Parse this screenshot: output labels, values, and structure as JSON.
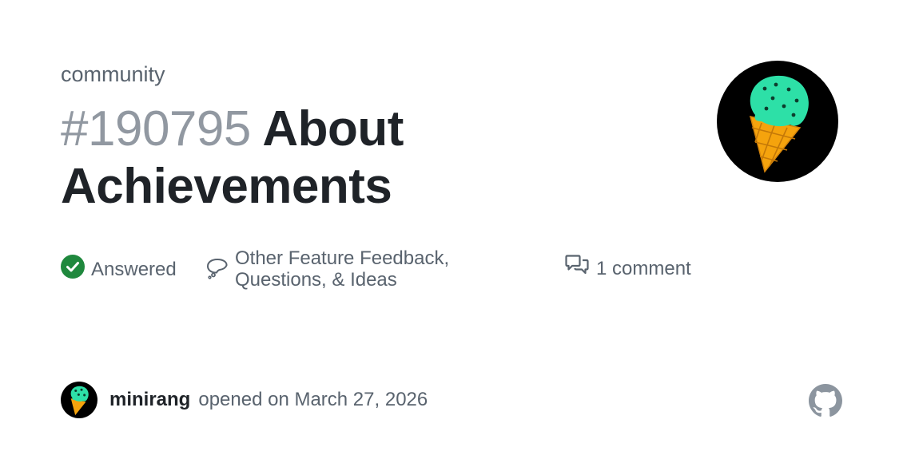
{
  "repo": {
    "owner": "community"
  },
  "discussion": {
    "number": "#190795",
    "title": "About Achievements",
    "status": "Answered",
    "category_line1": "Other Feature Feedback,",
    "category_line2": "Questions, & Ideas",
    "comments": "1 comment"
  },
  "author": {
    "username": "minirang",
    "opened": "opened on March 27, 2026",
    "avatar_icon": "ice-cream-cone-icon"
  },
  "icons": {
    "status": "check-circle-icon",
    "category": "thought-bubble-icon",
    "comments": "comment-discussion-icon",
    "brand": "github-mark-icon"
  },
  "colors": {
    "answered_green": "#1f883d",
    "mint": "#2de0a7",
    "cone_orange": "#f5a30d",
    "muted_text": "#59636e",
    "light_number": "#9198a1",
    "github_gray": "#8c959f"
  }
}
